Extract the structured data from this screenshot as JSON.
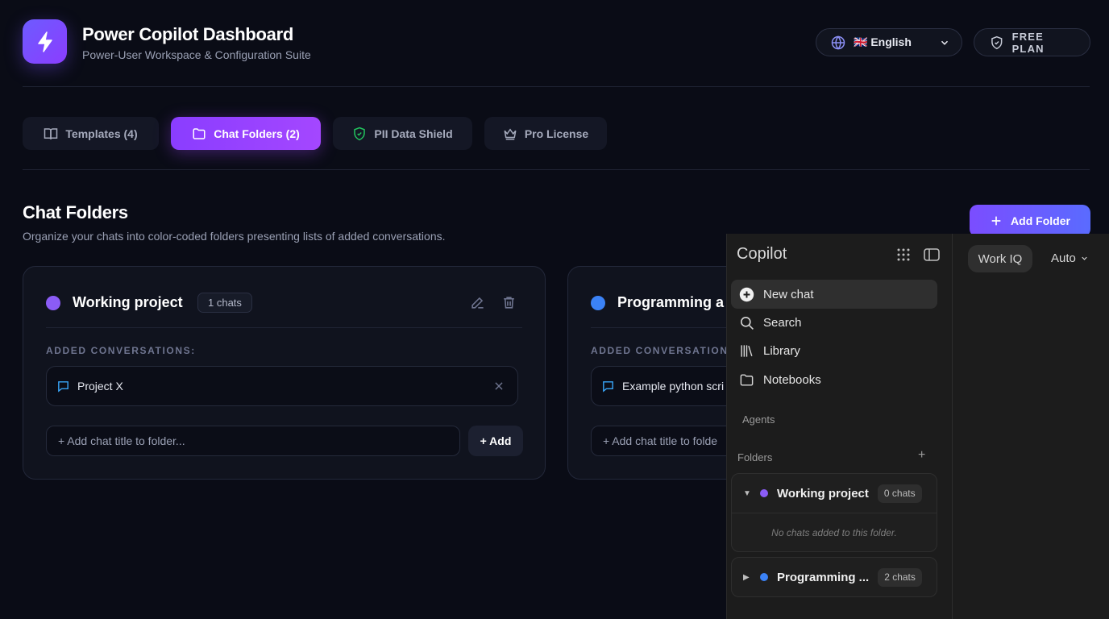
{
  "header": {
    "title": "Power Copilot Dashboard",
    "subtitle": "Power-User Workspace & Configuration Suite",
    "language_label": "🇬🇧 English",
    "plan_label": "FREE PLAN"
  },
  "tabs": [
    {
      "label": "Templates (4)",
      "icon": "book-icon",
      "active": false
    },
    {
      "label": "Chat Folders (2)",
      "icon": "folder-icon",
      "active": true
    },
    {
      "label": "PII Data Shield",
      "icon": "shield-icon",
      "active": false
    },
    {
      "label": "Pro License",
      "icon": "crown-icon",
      "active": false
    }
  ],
  "section": {
    "title": "Chat Folders",
    "subtitle": "Organize your chats into color-coded folders presenting lists of added conversations.",
    "add_folder_label": "Add Folder"
  },
  "folders": [
    {
      "name": "Working project",
      "count": "1 chats",
      "color": "#8b5cf6",
      "added_label": "ADDED CONVERSATIONS:",
      "conversations": [
        "Project X"
      ],
      "input_placeholder": "+ Add chat title to folder...",
      "add_label": "+ Add"
    },
    {
      "name": "Programming a",
      "color": "#3b82f6",
      "added_label": "ADDED CONVERSATIONS:",
      "conversations": [
        "Example python scri"
      ],
      "input_placeholder": "+ Add chat title to folde"
    }
  ],
  "copilot": {
    "title": "Copilot",
    "work_iq": "Work IQ",
    "mode": "Auto",
    "nav": [
      {
        "label": "New chat",
        "icon": "plus-circle-icon"
      },
      {
        "label": "Search",
        "icon": "search-icon"
      },
      {
        "label": "Library",
        "icon": "library-icon"
      },
      {
        "label": "Notebooks",
        "icon": "notebook-folder-icon"
      }
    ],
    "agents_label": "Agents",
    "folders_label": "Folders",
    "folders": [
      {
        "name": "Working project",
        "count": "0 chats",
        "color": "#8b5cf6",
        "expanded": true,
        "empty_text": "No chats added to this folder."
      },
      {
        "name": "Programming ...",
        "count": "2 chats",
        "color": "#3b82f6",
        "expanded": false
      }
    ]
  }
}
